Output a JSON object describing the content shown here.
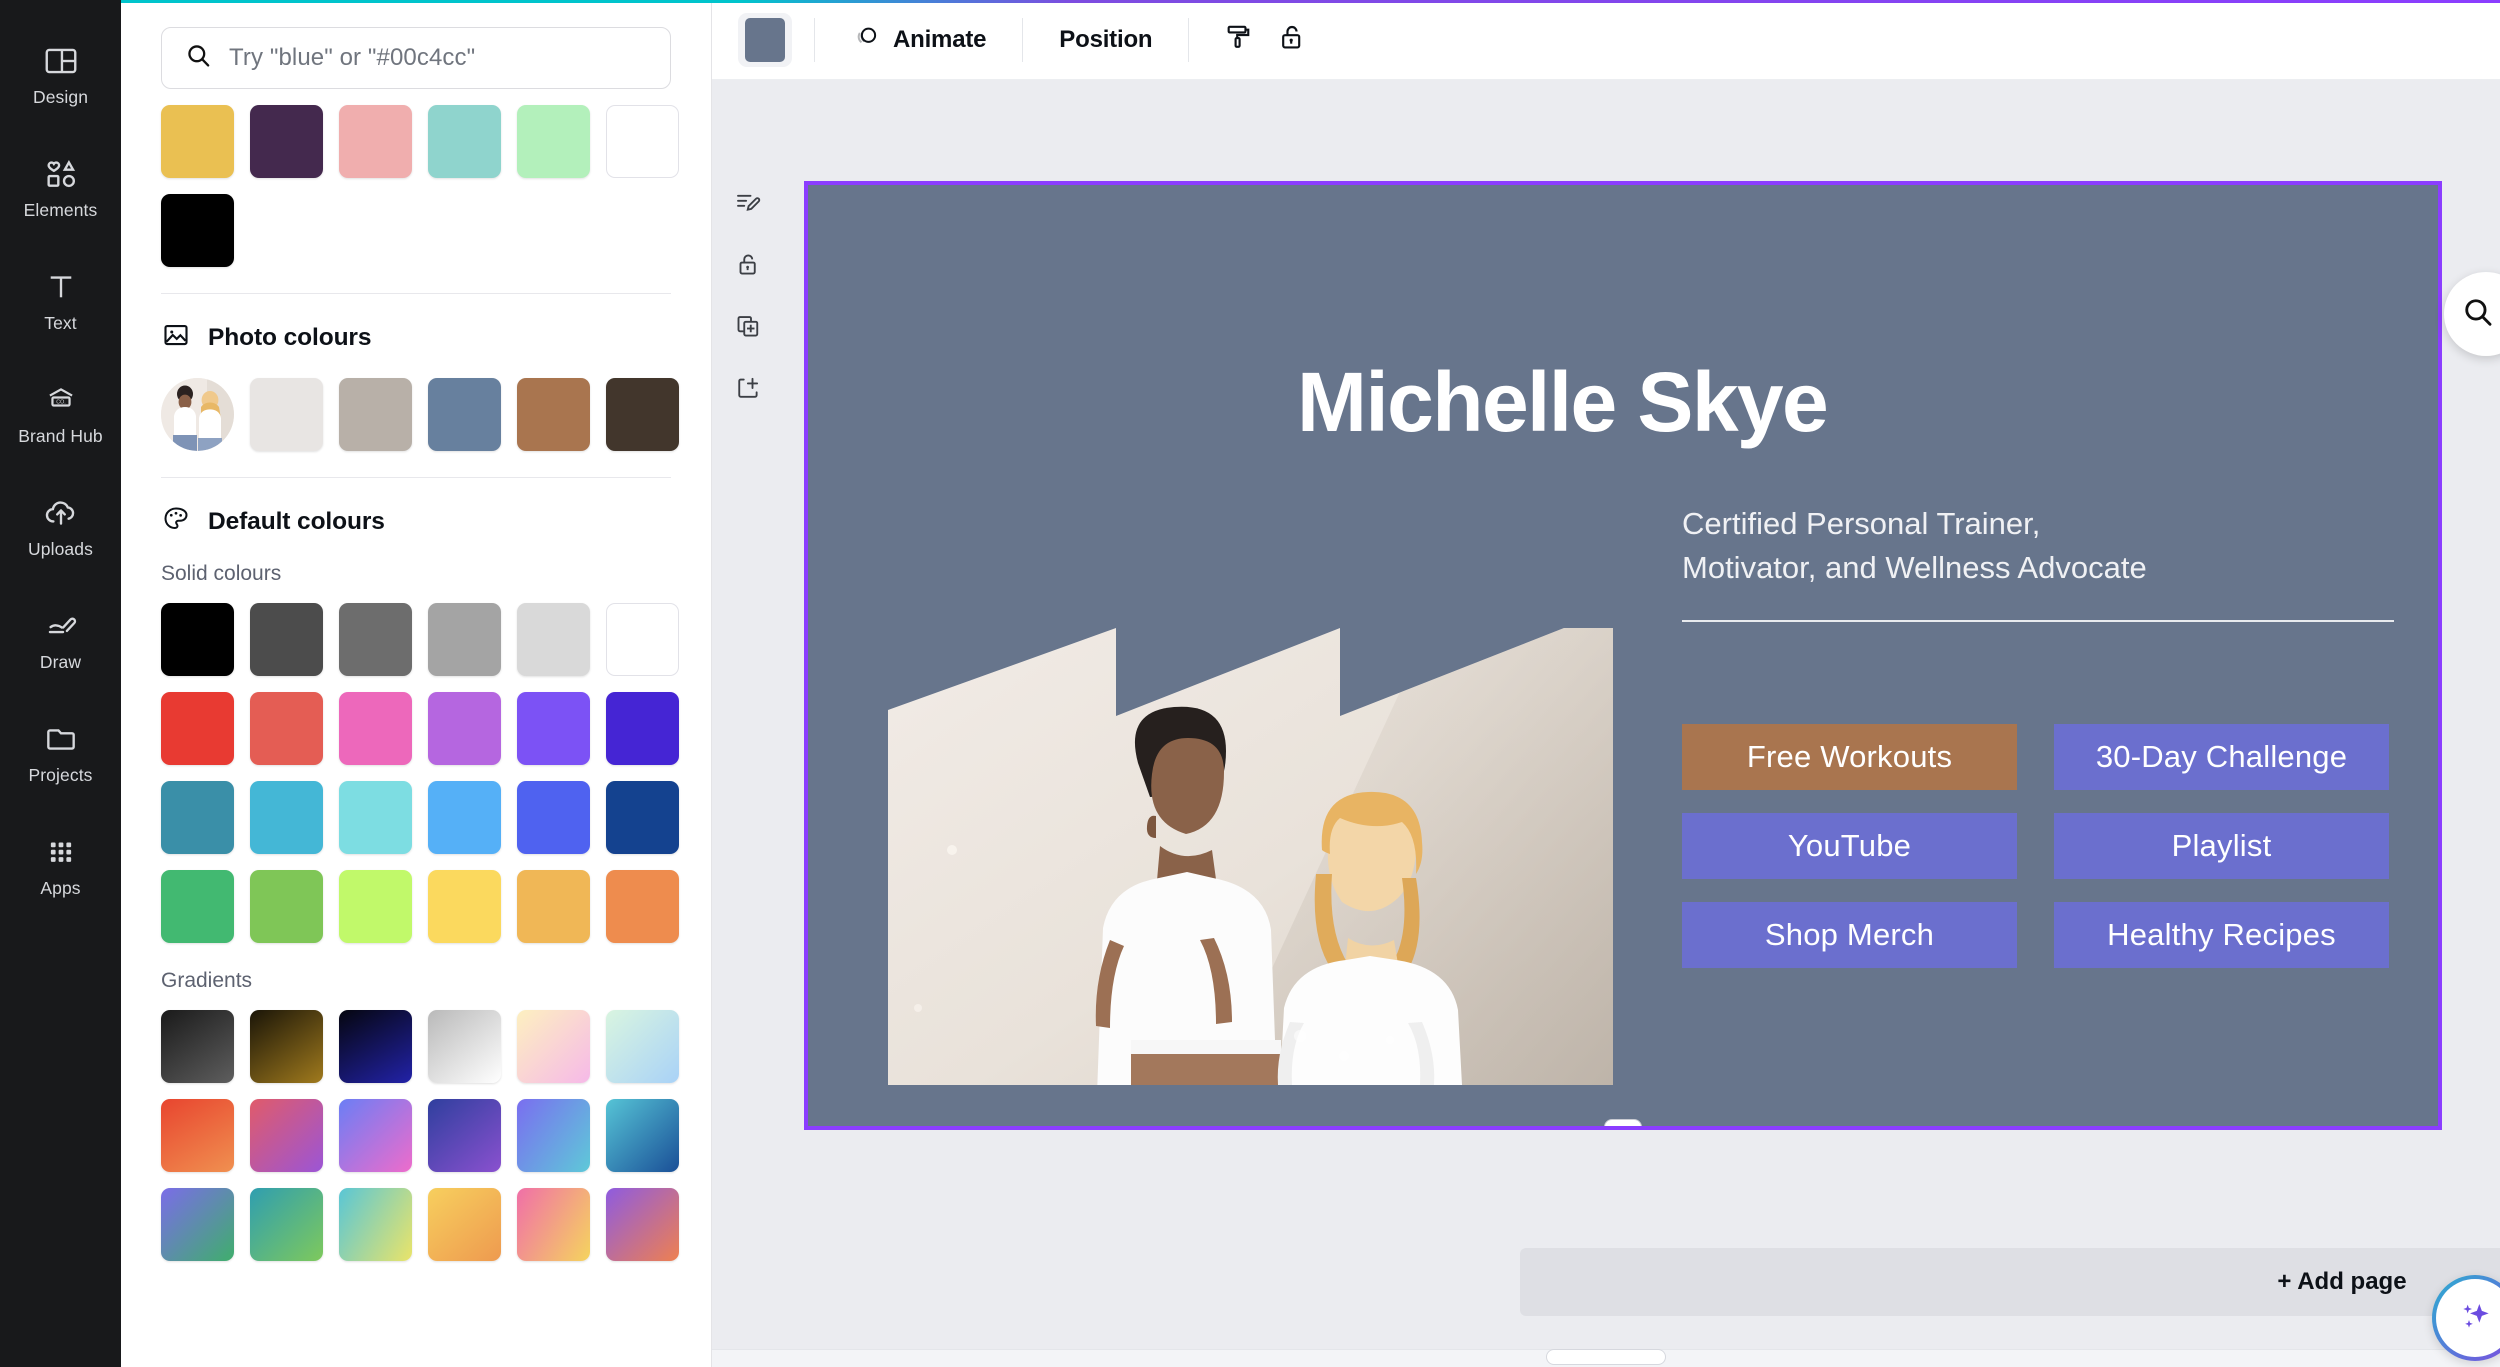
{
  "rail": {
    "items": [
      {
        "label": "Design",
        "icon": "design-icon"
      },
      {
        "label": "Elements",
        "icon": "elements-icon"
      },
      {
        "label": "Text",
        "icon": "text-icon"
      },
      {
        "label": "Brand Hub",
        "icon": "brand-hub-icon"
      },
      {
        "label": "Uploads",
        "icon": "uploads-icon"
      },
      {
        "label": "Draw",
        "icon": "draw-icon"
      },
      {
        "label": "Projects",
        "icon": "projects-icon"
      },
      {
        "label": "Apps",
        "icon": "apps-icon"
      }
    ]
  },
  "search": {
    "placeholder": "Try \"blue\" or \"#00c4cc\"",
    "icon": "search-icon"
  },
  "brand_colours": {
    "swatches": [
      "#eac052",
      "#44294e",
      "#f0aeae",
      "#8fd4cd",
      "#b3f0bb",
      "#ffffff",
      "#000000"
    ]
  },
  "photo_colours": {
    "title": "Photo colours",
    "icon": "image-icon",
    "thumbnail_label": "photo-thumbnail",
    "swatches": [
      "#e8e5e3",
      "#b8b0a8",
      "#67809e",
      "#a9754f",
      "#42362c"
    ]
  },
  "default_colours": {
    "title": "Default colours",
    "icon": "palette-icon",
    "solid_label": "Solid colours",
    "gradients_label": "Gradients",
    "solid": [
      "#000000",
      "#4c4c4c",
      "#6d6d6d",
      "#a4a4a4",
      "#d9d9d9",
      "#ffffff",
      "#e83a32",
      "#e45d54",
      "#ed68bb",
      "#b566e0",
      "#7c52f5",
      "#4525d4",
      "#3a8fa8",
      "#44b7d6",
      "#7ddde2",
      "#55b0f7",
      "#4f62f0",
      "#14428f",
      "#42b971",
      "#7fc657",
      "#c1f96a",
      "#fbd95e",
      "#f0b756",
      "#ee8c4e"
    ],
    "gradients": [
      "linear-gradient(145deg,#1a1a1a,#5e5e5e)",
      "linear-gradient(145deg,#1a1508,#a07a1d)",
      "linear-gradient(150deg,#05060f,#2222a8)",
      "linear-gradient(140deg,#b9b9b9,#ffffff)",
      "linear-gradient(135deg,#fdf0c0,#f6b9e8)",
      "linear-gradient(135deg,#d9f5e0,#a9d2f7)",
      "linear-gradient(150deg,#e8452f,#f09050)",
      "linear-gradient(135deg,#e05b6a,#9b55d6)",
      "linear-gradient(135deg,#6b7ef5,#ee6ccb)",
      "linear-gradient(140deg,#2f3f9e,#8a51cf)",
      "linear-gradient(125deg,#7a6ef0,#5ec9d8)",
      "linear-gradient(135deg,#56c4d6,#1a4f97)",
      "linear-gradient(135deg,#7b6ce8,#3fae6c)",
      "linear-gradient(135deg,#2f9eb0,#7ec95c)",
      "linear-gradient(120deg,#59c6d6,#eae469)",
      "linear-gradient(140deg,#f7cf5e,#ee9a4f)",
      "linear-gradient(120deg,#f06fa8,#f5d45e)",
      "linear-gradient(135deg,#8e5be0,#ee8050)"
    ]
  },
  "toolbar": {
    "selected_colour": "#67758c",
    "animate_label": "Animate",
    "position_label": "Position",
    "animate_icon": "animate-icon",
    "paint_roller_icon": "paint-roller-icon",
    "lock_icon": "unlock-icon",
    "colour_chip_name": "colour-chip"
  },
  "float_tools": [
    {
      "icon": "notes-edit-icon"
    },
    {
      "icon": "unlock-icon"
    },
    {
      "icon": "duplicate-page-icon"
    },
    {
      "icon": "add-page-icon"
    }
  ],
  "design": {
    "background_colour": "#67758c",
    "title": "Michelle Skye",
    "subtitle": "Certified Personal Trainer,\nMotivator, and Wellness Advocate",
    "buttons": [
      {
        "label": "Free Workouts",
        "colour": "#a9754f"
      },
      {
        "label": "30-Day Challenge",
        "colour": "#6b6fce"
      },
      {
        "label": "YouTube",
        "colour": "#6b6fce"
      },
      {
        "label": "Playlist",
        "colour": "#6b6fce"
      },
      {
        "label": "Shop Merch",
        "colour": "#6b6fce"
      },
      {
        "label": "Healthy Recipes",
        "colour": "#6b6fce"
      }
    ]
  },
  "canvas": {
    "add_page_label": "+ Add page",
    "selection_colour": "#8b3dff",
    "search_fab_icon": "search-icon",
    "magic_fab_icon": "magic-sparkle-icon"
  }
}
